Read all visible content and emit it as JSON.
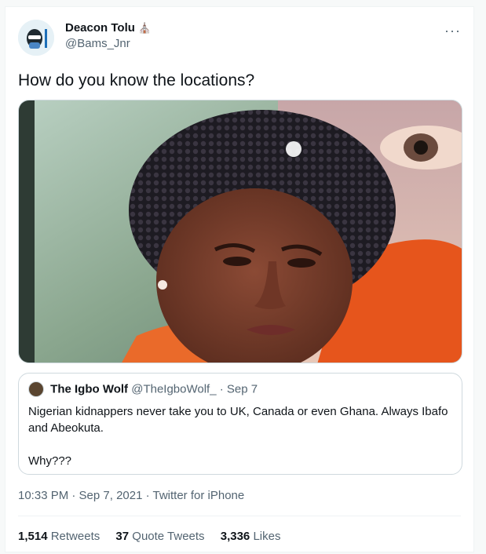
{
  "tweet": {
    "author_name": "Deacon Tolu",
    "author_emoji": "⛪",
    "handle": "@Bams_Jnr",
    "more_label": "···",
    "text": "How do you know the locations?",
    "timestamp": "10:33 PM · Sep 7, 2021 · Twitter for iPhone"
  },
  "quoted_tweet": {
    "author_name": "The Igbo Wolf",
    "handle": "@TheIgboWolf_",
    "date": "· Sep 7",
    "line1": "Nigerian kidnappers never take you to UK, Canada or even Ghana. Always Ibafo and Abeokuta.",
    "line2": "Why???"
  },
  "stats": {
    "retweets_count": "1,514",
    "retweets_label": "Retweets",
    "quotes_count": "37",
    "quotes_label": "Quote Tweets",
    "likes_count": "3,336",
    "likes_label": "Likes"
  },
  "colors": {
    "text_primary": "#0f1419",
    "text_secondary": "#536471",
    "border": "#cfd9de",
    "divider": "#eff3f4"
  }
}
